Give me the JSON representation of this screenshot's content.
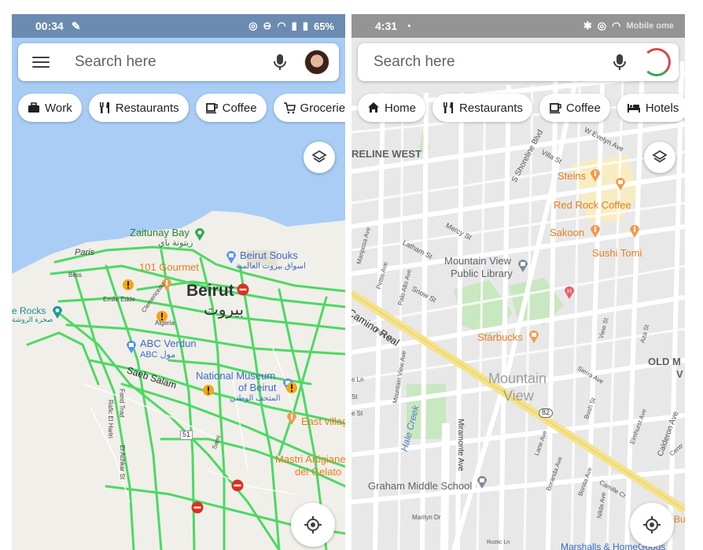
{
  "left": {
    "status": {
      "time": "00:34",
      "battery": "65%"
    },
    "search": {
      "placeholder": "Search here"
    },
    "chips": [
      {
        "label": "Work",
        "icon": "briefcase-icon"
      },
      {
        "label": "Restaurants",
        "icon": "restaurant-icon"
      },
      {
        "label": "Coffee",
        "icon": "coffee-icon"
      },
      {
        "label": "Groceries",
        "icon": "cart-icon"
      }
    ],
    "map_labels": {
      "zaitunay_bay": "Zaitunay Bay",
      "zaitunay_bay_ar": "زيتونة باي",
      "beirut_souks": "Beirut Souks",
      "beirut_souks_ar": "اسواق بيروت العالمية",
      "gourmet": "101 Gourmet",
      "beirut": "Beirut",
      "beirut_ar": "بيروت",
      "paris": "Paris",
      "bliss": "Bliss",
      "emile_edde": "Emile Edde",
      "algeria": "Algeria",
      "clemenceau": "Clemenceau",
      "rocks": "e Rocks",
      "rocks_ar": "صخرة الروشة",
      "abc_verdun": "ABC Verdun",
      "abc_verdun_ar": "ABC مول",
      "national_museum": "National Museum",
      "of_beirut": "of Beirut",
      "national_museum_ar": "المتحف الوطني",
      "saeb_salam": "Saeb Salam",
      "farid_trad": "Farid Trad",
      "rafic_el_hariri": "Rafic El Hariri",
      "el_achkar": "El Achkar St",
      "east_village": "East villag",
      "mastri": "Mastri Artigiane",
      "del_gelato": "del Gelato",
      "route_51": "51",
      "sami": "Sami"
    }
  },
  "right": {
    "status": {
      "time": "4:31",
      "extra": "Mobile ome"
    },
    "search": {
      "placeholder": "Search here"
    },
    "chips": [
      {
        "label": "Home",
        "icon": "home-icon"
      },
      {
        "label": "Restaurants",
        "icon": "restaurant-icon"
      },
      {
        "label": "Coffee",
        "icon": "coffee-icon"
      },
      {
        "label": "Hotels",
        "icon": "hotel-icon"
      }
    ],
    "map_labels": {
      "shoreline_west": "RELINE WEST",
      "shoreline_blvd": "S Shoreline Blvd",
      "villa_st": "Villa St",
      "w_evelyn": "W Evelyn Ave",
      "steins": "Steins",
      "red_rock": "Red Rock Coffee",
      "sakoon": "Sakoon",
      "sushi_tomi": "Sushi Tomi",
      "mercy_st": "Mercy St",
      "latham_st": "Latham St",
      "library_1": "Mountain View",
      "library_2": "Public Library",
      "mariposa": "Mariposa Ave",
      "pettis": "Pettis Ave",
      "palo_alto": "Palo Alto Ave",
      "snow_st": "Snow St",
      "camino_real": "Camino Real",
      "park_dr": "Park Dr",
      "starbucks": "Starbucks",
      "mtn_view_1": "Mountain",
      "mtn_view_2": "View",
      "old_m": "OLD M",
      "old_m_2": "V",
      "route_82": "82",
      "sierra_ave": "Sierra Ave",
      "view_st": "View St",
      "aza_st": "Aza St",
      "hale_creek": "Hale Creek",
      "miramonte": "Miramonte Ave",
      "mountain_view_ave": "Mountain View Ave",
      "e_ln": "e Ln",
      "st_1": "St",
      "e_st": "e St",
      "lane_ave": "Lane Ave",
      "bush_st": "Bush St",
      "elmhurst": "Elmhurst Ave",
      "calderon": "Calderon Ave",
      "centre": "Centr",
      "boranda": "Boranda Ave",
      "bonita": "Bonita Ave",
      "nilda": "Nilda Ave",
      "camille": "Camille Ct",
      "graham": "Graham Middle School",
      "marilyn": "Marilyn Dr",
      "rustic": "Rustic Ln",
      "marshalls": "Marshalls & HomeGoods",
      "bu": "Bu"
    }
  },
  "colors": {
    "water": "#a9cdf5",
    "land": "#f1efe9",
    "traffic": "#4cd964",
    "map_gray": "#e8e8e8",
    "road_yellow": "#f5e28c",
    "park": "#c9e7c0",
    "food": "#f29a4b",
    "red_marker": "#e85b63"
  }
}
